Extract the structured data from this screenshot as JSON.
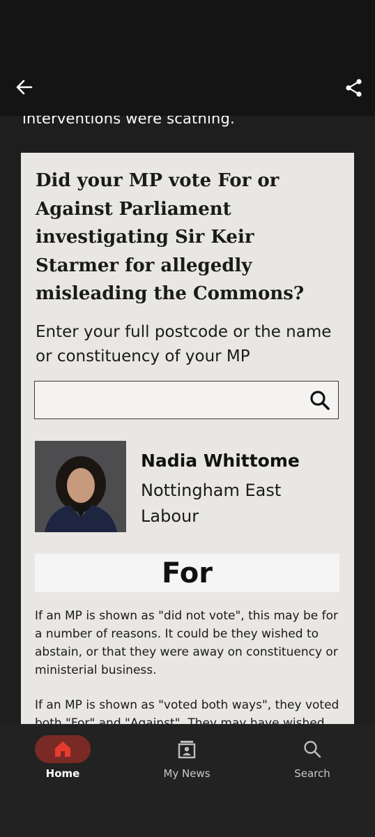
{
  "app_bar": {
    "back_icon": "arrow-left-icon",
    "share_icon": "share-icon"
  },
  "article": {
    "fragment": "interventions were scathing."
  },
  "lookup": {
    "question": "Did your MP vote For or Against Parliament investigating Sir Keir Starmer for allegedly misleading the Commons?",
    "prompt": "Enter your full postcode or the name or constituency of your MP",
    "search_value": "",
    "search_placeholder": "",
    "search_icon": "search-icon"
  },
  "mp": {
    "name": "Nadia Whittome",
    "constituency": "Nottingham East",
    "party": "Labour",
    "vote": "For"
  },
  "notes": [
    "If an MP is shown as \"did not vote\", this may be for a number of reasons. It could be they wished to abstain, or that they were away on constituency or ministerial business.",
    "If an MP is shown as \"voted both ways\", they voted both \"For\" and \"Against\". They may have wished"
  ],
  "bottom_nav": [
    {
      "label": "Home",
      "icon": "home-icon",
      "active": true
    },
    {
      "label": "My News",
      "icon": "my-news-icon",
      "active": false
    },
    {
      "label": "Search",
      "icon": "search-icon",
      "active": false
    }
  ],
  "colors": {
    "accent": "#e83a2e",
    "active_pill": "#7a2a24",
    "card_bg": "#e9e7e3"
  }
}
